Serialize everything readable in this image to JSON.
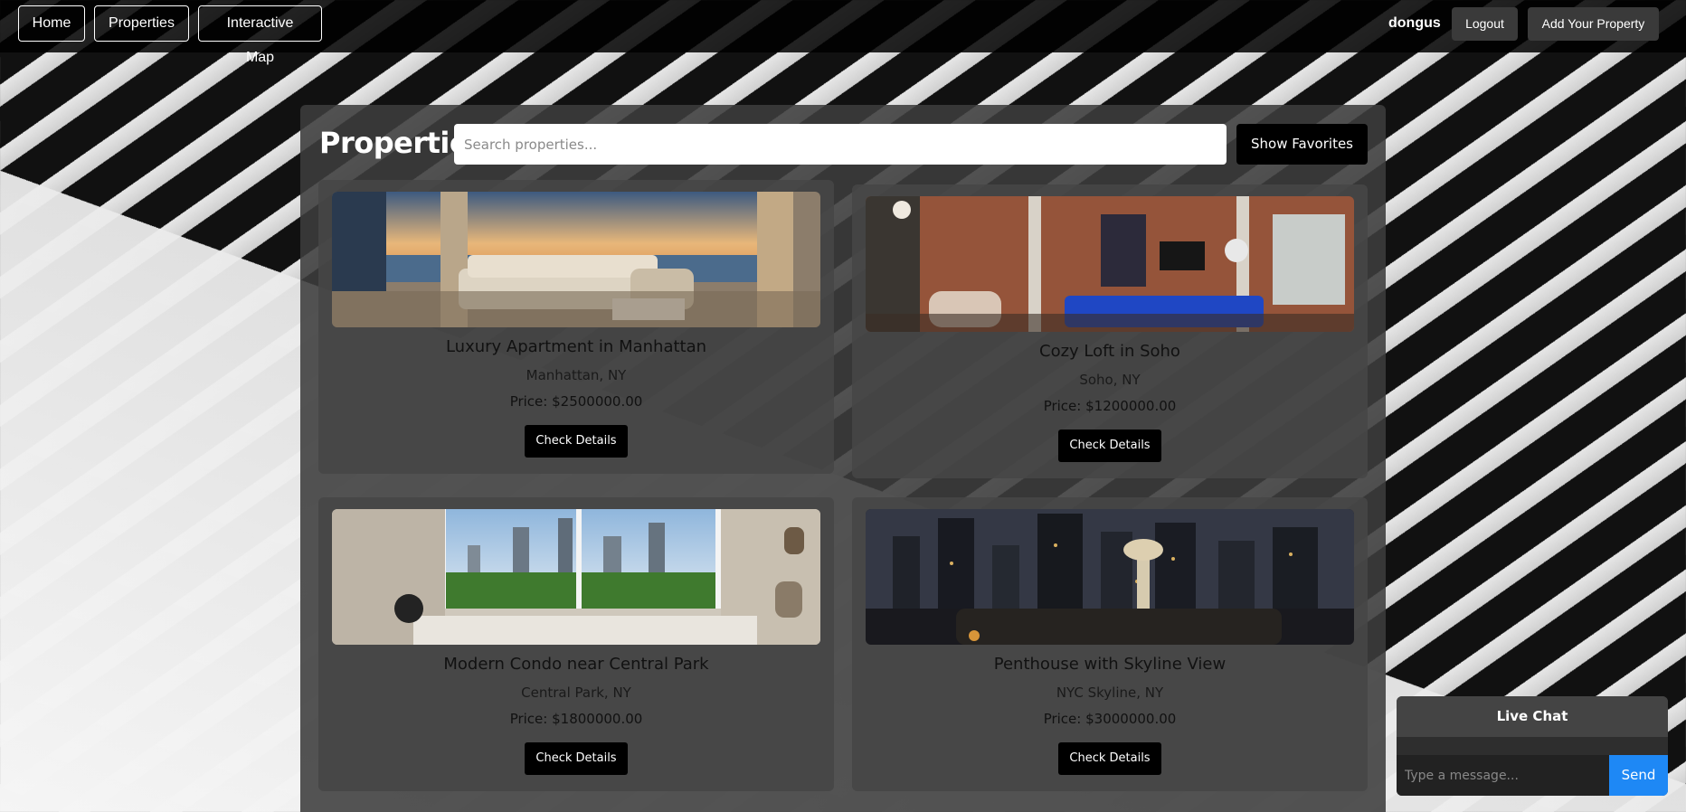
{
  "nav": {
    "home_label": "Home",
    "properties_label": "Properties",
    "map_label": "Interactive Map",
    "username": "dongus",
    "logout_label": "Logout",
    "add_property_label": "Add Your Property"
  },
  "page": {
    "title": "Properties",
    "search_placeholder": "Search properties...",
    "show_favorites_label": "Show Favorites"
  },
  "properties": [
    {
      "title": "Luxury Apartment in Manhattan",
      "location": "Manhattan, NY",
      "price": "Price: $2500000.00",
      "button_label": "Check Details"
    },
    {
      "title": "Cozy Loft in Soho",
      "location": "Soho, NY",
      "price": "Price: $1200000.00",
      "button_label": "Check Details"
    },
    {
      "title": "Modern Condo near Central Park",
      "location": "Central Park, NY",
      "price": "Price: $1800000.00",
      "button_label": "Check Details"
    },
    {
      "title": "Penthouse with Skyline View",
      "location": "NYC Skyline, NY",
      "price": "Price: $3000000.00",
      "button_label": "Check Details"
    }
  ],
  "chat": {
    "title": "Live Chat",
    "input_placeholder": "Type a message...",
    "send_label": "Send"
  },
  "colors": {
    "nav_bg": "#0d0d0d",
    "panel_bg": "#3c3c3c",
    "button_black": "#000000",
    "send_blue": "#1e88f5"
  }
}
